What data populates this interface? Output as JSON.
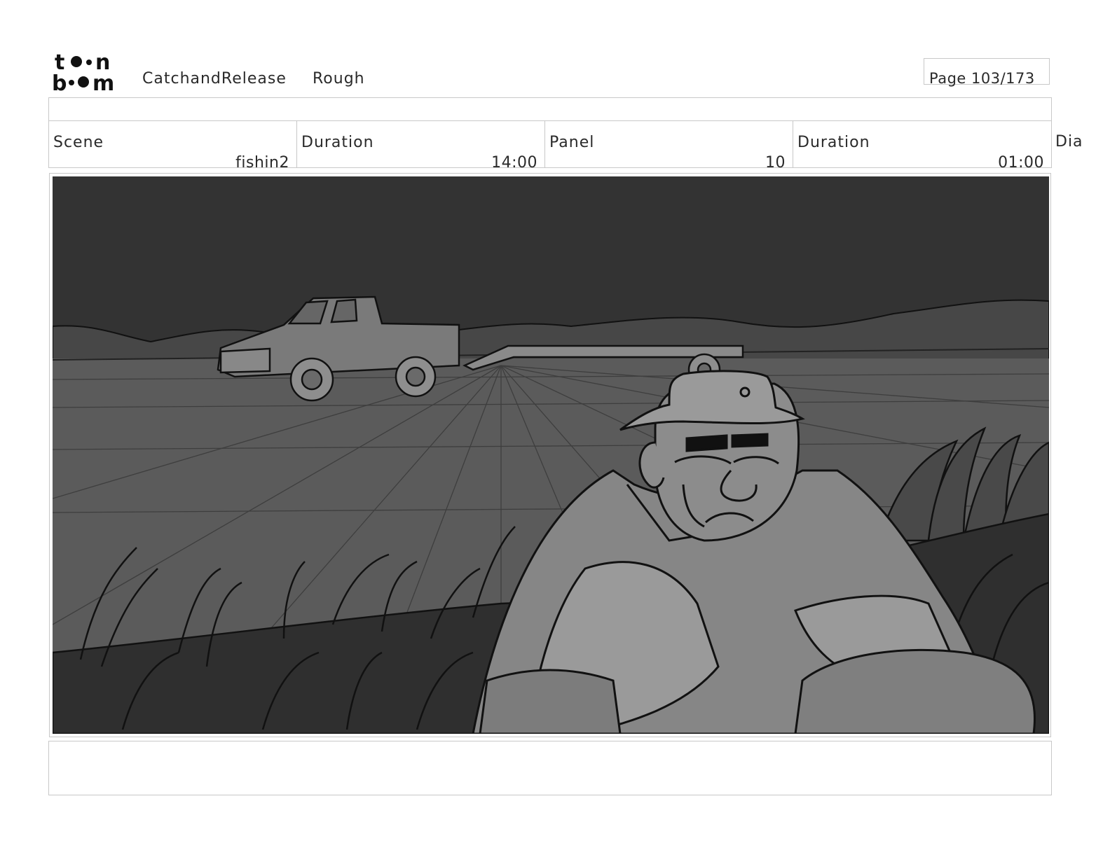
{
  "header": {
    "logo_icon": "toonboom-logo-icon",
    "project": "CatchandRelease",
    "stage": "Rough",
    "page": "Page 103/173"
  },
  "info": {
    "scene_label": "Scene",
    "scene_value": "fishin2",
    "scene_duration_label": "Duration",
    "scene_duration_value": "14:00",
    "panel_label": "Panel",
    "panel_value": "10",
    "panel_duration_label": "Duration",
    "panel_duration_value": "01:00",
    "dialogue_label": "Dia"
  },
  "colors": {
    "sky": "#323232",
    "field": "#5a5a5a",
    "grass": "#2f2f2f",
    "figure": "#8a8a8a",
    "line": "#111111"
  }
}
